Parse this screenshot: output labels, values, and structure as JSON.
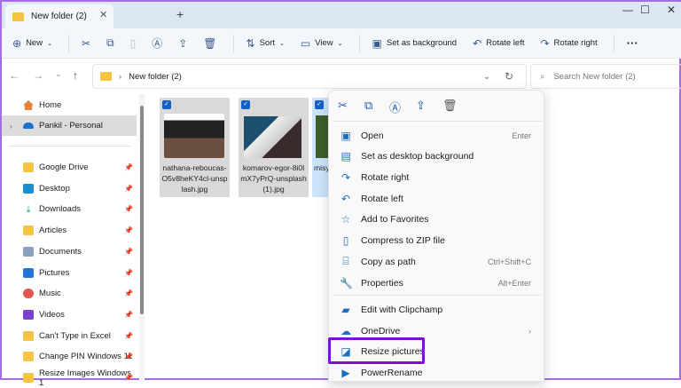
{
  "window": {
    "tab_title": "New folder (2)",
    "close_tab": "✕",
    "new_tab": "+",
    "minimize": "—",
    "maximize": "☐",
    "close": "✕"
  },
  "toolbar": {
    "new": "New",
    "sort": "Sort",
    "view": "View",
    "set_background": "Set as background",
    "rotate_left": "Rotate left",
    "rotate_right": "Rotate right",
    "more": "···"
  },
  "address": {
    "path": "New folder (2)",
    "search_placeholder": "Search New folder (2)"
  },
  "sidebar": {
    "items": [
      {
        "label": "Home"
      },
      {
        "label": "Pankil - Personal"
      },
      {
        "label": "Google Drive"
      },
      {
        "label": "Desktop"
      },
      {
        "label": "Downloads"
      },
      {
        "label": "Articles"
      },
      {
        "label": "Documents"
      },
      {
        "label": "Pictures"
      },
      {
        "label": "Music"
      },
      {
        "label": "Videos"
      },
      {
        "label": "Can't Type in Excel"
      },
      {
        "label": "Change PIN Windows 11"
      },
      {
        "label": "Resize Images Windows 1"
      }
    ]
  },
  "files": [
    {
      "name": "nathana-reboucas-O5v8heKY4cl-unsplash.jpg"
    },
    {
      "name": "komarov-egor-8i0lmX7yPrQ-unsplash (1).jpg"
    },
    {
      "name": "misyCX"
    }
  ],
  "context_menu": {
    "items": [
      {
        "label": "Open",
        "shortcut": "Enter"
      },
      {
        "label": "Set as desktop background",
        "shortcut": ""
      },
      {
        "label": "Rotate right",
        "shortcut": ""
      },
      {
        "label": "Rotate left",
        "shortcut": ""
      },
      {
        "label": "Add to Favorites",
        "shortcut": ""
      },
      {
        "label": "Compress to ZIP file",
        "shortcut": ""
      },
      {
        "label": "Copy as path",
        "shortcut": "Ctrl+Shift+C"
      },
      {
        "label": "Properties",
        "shortcut": "Alt+Enter"
      },
      {
        "label": "Edit with Clipchamp",
        "shortcut": ""
      },
      {
        "label": "OneDrive",
        "shortcut": "›"
      },
      {
        "label": "Resize pictures",
        "shortcut": ""
      },
      {
        "label": "PowerRename",
        "shortcut": ""
      }
    ]
  },
  "colors": {
    "accent": "#1560c8",
    "highlight": "#7a12d4"
  }
}
